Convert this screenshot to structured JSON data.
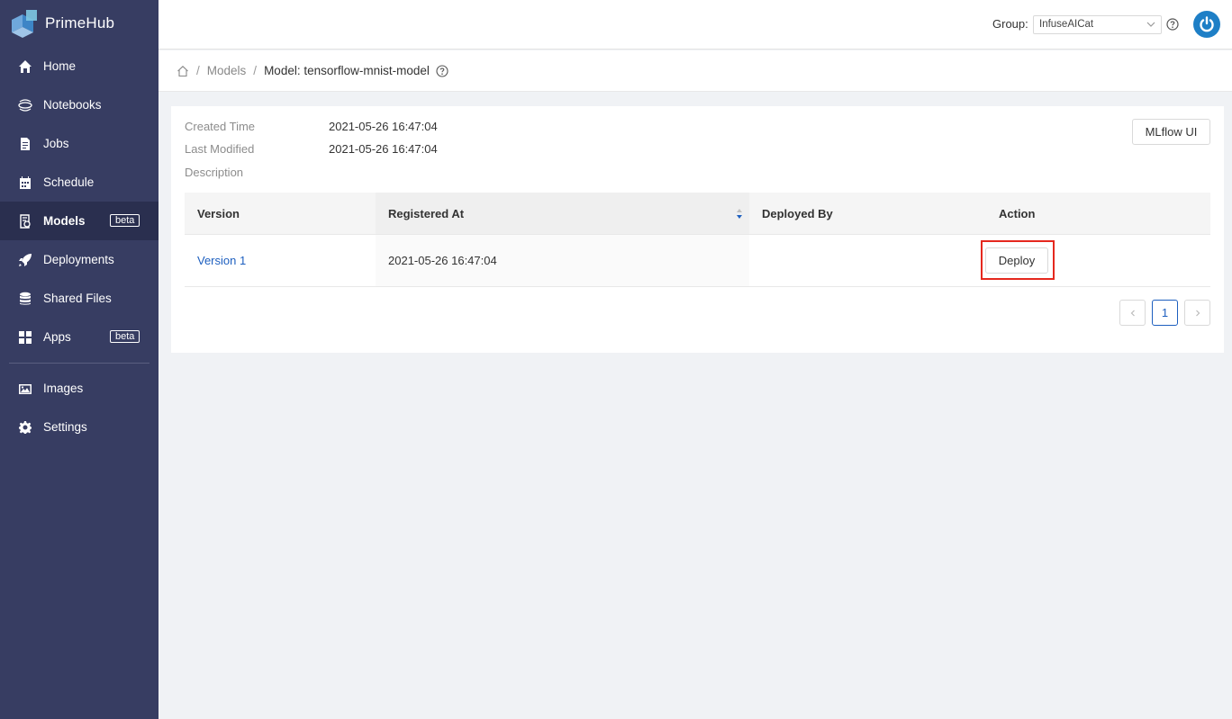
{
  "brand": {
    "name": "PrimeHub"
  },
  "sidebar": {
    "items": [
      {
        "label": "Home",
        "icon": "home-icon"
      },
      {
        "label": "Notebooks",
        "icon": "jupyter-icon"
      },
      {
        "label": "Jobs",
        "icon": "file-icon"
      },
      {
        "label": "Schedule",
        "icon": "calendar-icon"
      },
      {
        "label": "Models",
        "icon": "model-icon",
        "badge": "beta",
        "active": true
      },
      {
        "label": "Deployments",
        "icon": "rocket-icon"
      },
      {
        "label": "Shared Files",
        "icon": "database-icon"
      },
      {
        "label": "Apps",
        "icon": "apps-grid-icon",
        "badge": "beta"
      }
    ],
    "bottom_items": [
      {
        "label": "Images",
        "icon": "image-icon"
      },
      {
        "label": "Settings",
        "icon": "gear-icon"
      }
    ]
  },
  "header": {
    "group_label": "Group:",
    "group_value": "InfuseAICat"
  },
  "breadcrumb": {
    "parent": "Models",
    "current": "Model: tensorflow-mnist-model"
  },
  "model": {
    "created_label": "Created Time",
    "created_value": "2021-05-26 16:47:04",
    "modified_label": "Last Modified",
    "modified_value": "2021-05-26 16:47:04",
    "description_label": "Description",
    "mlflow_button": "MLflow UI"
  },
  "table": {
    "columns": [
      "Version",
      "Registered At",
      "Deployed By",
      "Action"
    ],
    "rows": [
      {
        "version": "Version 1",
        "registered_at": "2021-05-26 16:47:04",
        "deployed_by": "",
        "action": "Deploy"
      }
    ]
  },
  "pagination": {
    "current_page": "1"
  },
  "colors": {
    "sidebar": "#373d62",
    "accent": "#1d5fbf",
    "highlight": "#e5281e"
  }
}
